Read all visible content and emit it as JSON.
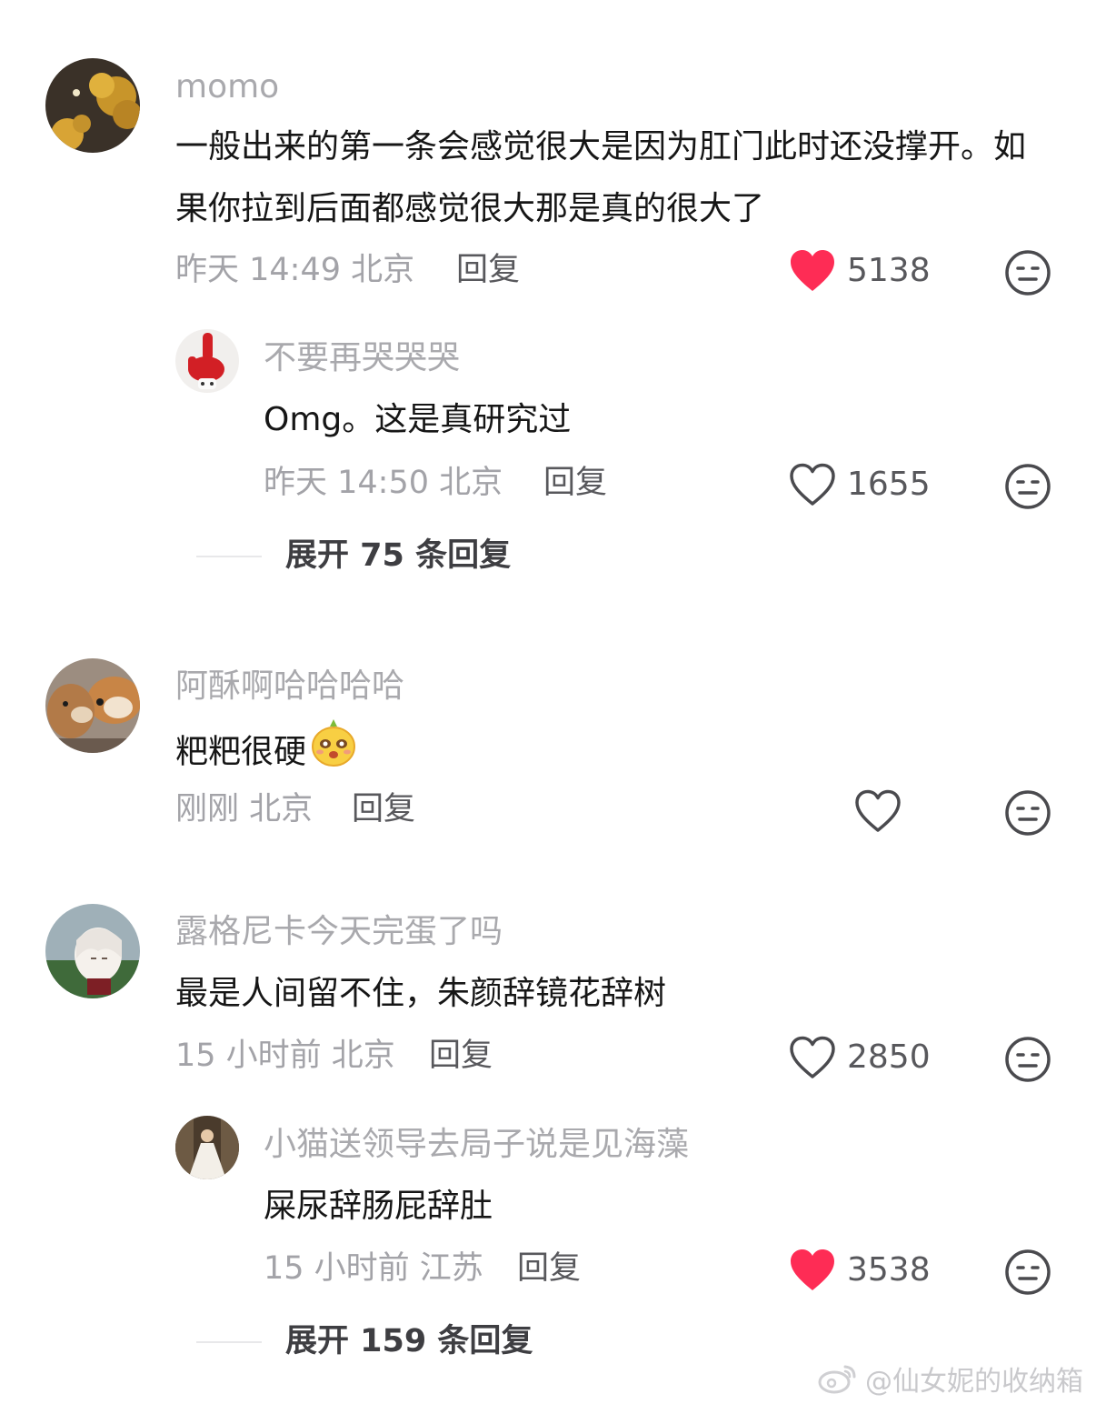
{
  "comments": [
    {
      "username": "momo",
      "text": "一般出来的第一条会感觉很大是因为肛门此时还没撑开。如果你拉到后面都感觉很大那是真的很大了",
      "time_location": "昨天 14:49 北京",
      "reply_label": "回复",
      "likes": "5138",
      "liked": true,
      "avatar_icon": "golden-tree-avatar",
      "reaction_icon": "meh-face-icon",
      "replies": [
        {
          "username": "不要再哭哭哭",
          "text": "Omg。这是真研究过",
          "time_location": "昨天 14:50 北京",
          "reply_label": "回复",
          "likes": "1655",
          "liked": false,
          "avatar_icon": "red-hand-puppet-avatar"
        }
      ],
      "expand_label": "展开 75 条回复"
    },
    {
      "username": "阿酥啊哈哈哈哈",
      "text": "粑粑很硬",
      "emoji_icon": "yellow-face-emoji",
      "time_location": "刚刚 北京",
      "reply_label": "回复",
      "likes": "",
      "liked": false,
      "avatar_icon": "shiba-dogs-avatar"
    },
    {
      "username": "露格尼卡今天完蛋了吗",
      "text": "最是人间留不住，朱颜辞镜花辞树",
      "time_location": "15 小时前 北京",
      "reply_label": "回复",
      "likes": "2850",
      "liked": false,
      "avatar_icon": "anime-character-avatar",
      "replies": [
        {
          "username": "小猫送领导去局子说是见海藻",
          "text": "屎尿辞肠屁辞肚",
          "time_location": "15 小时前 江苏",
          "reply_label": "回复",
          "likes": "3538",
          "liked": true,
          "avatar_icon": "gown-portrait-avatar"
        }
      ],
      "expand_label": "展开 159 条回复"
    }
  ],
  "watermark": "@仙女妮的收纳箱",
  "colors": {
    "liked_heart": "#fe2c55",
    "username": "#a9a9ad",
    "meta": "#a3a3a8",
    "text": "#161616"
  }
}
